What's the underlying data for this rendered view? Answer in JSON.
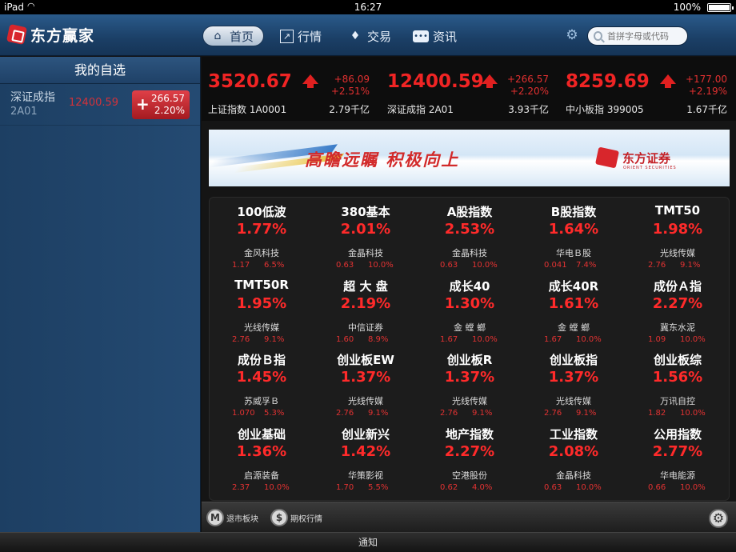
{
  "statusbar": {
    "device": "iPad",
    "time": "16:27",
    "battery": "100%"
  },
  "app": {
    "name": "东方赢家"
  },
  "nav": {
    "tabs": [
      {
        "label": "首页",
        "icon": "home-icon",
        "active": true
      },
      {
        "label": "行情",
        "icon": "chart-icon",
        "active": false
      },
      {
        "label": "交易",
        "icon": "money-bag-icon",
        "active": false
      },
      {
        "label": "资讯",
        "icon": "chat-icon",
        "active": false
      }
    ],
    "search_placeholder": "首拼字母或代码"
  },
  "sidebar": {
    "title": "我的自选",
    "items": [
      {
        "name": "深证成指",
        "code": "2A01",
        "price": "12400.59",
        "change": "266.57",
        "pct": "2.20%"
      }
    ]
  },
  "indices": [
    {
      "price": "3520.67",
      "change": "+86.09",
      "pct": "+2.51%",
      "name": "上证指数 1A0001",
      "volume": "2.79千亿"
    },
    {
      "price": "12400.59",
      "change": "+266.57",
      "pct": "+2.20%",
      "name": "深证成指 2A01",
      "volume": "3.93千亿"
    },
    {
      "price": "8259.69",
      "change": "+177.00",
      "pct": "+2.19%",
      "name": "中小板指 399005",
      "volume": "1.67千亿"
    }
  ],
  "banner": {
    "slogan": "高瞻远瞩  积极向上",
    "brand": "东方证券",
    "brand_en": "ORIENT SECURITIES"
  },
  "sectors": [
    {
      "name": "100低波",
      "pct": "1.77%",
      "stock": "金风科技",
      "price": "1.17",
      "rise": "6.5%"
    },
    {
      "name": "380基本",
      "pct": "2.01%",
      "stock": "金晶科技",
      "price": "0.63",
      "rise": "10.0%"
    },
    {
      "name": "A股指数",
      "pct": "2.53%",
      "stock": "金晶科技",
      "price": "0.63",
      "rise": "10.0%"
    },
    {
      "name": "B股指数",
      "pct": "1.64%",
      "stock": "华电Ｂ股",
      "price": "0.041",
      "rise": "7.4%"
    },
    {
      "name": "TMT50",
      "pct": "1.98%",
      "stock": "光线传媒",
      "price": "2.76",
      "rise": "9.1%"
    },
    {
      "name": "TMT50R",
      "pct": "1.95%",
      "stock": "光线传媒",
      "price": "2.76",
      "rise": "9.1%"
    },
    {
      "name": "超 大 盘",
      "pct": "2.19%",
      "stock": "中信证券",
      "price": "1.60",
      "rise": "8.9%"
    },
    {
      "name": "成长40",
      "pct": "1.30%",
      "stock": "金 螳 螂",
      "price": "1.67",
      "rise": "10.0%"
    },
    {
      "name": "成长40R",
      "pct": "1.61%",
      "stock": "金 螳 螂",
      "price": "1.67",
      "rise": "10.0%"
    },
    {
      "name": "成份Ａ指",
      "pct": "2.27%",
      "stock": "冀东水泥",
      "price": "1.09",
      "rise": "10.0%"
    },
    {
      "name": "成份Ｂ指",
      "pct": "1.45%",
      "stock": "苏威孚Ｂ",
      "price": "1.070",
      "rise": "5.3%"
    },
    {
      "name": "创业板EW",
      "pct": "1.37%",
      "stock": "光线传媒",
      "price": "2.76",
      "rise": "9.1%"
    },
    {
      "name": "创业板R",
      "pct": "1.37%",
      "stock": "光线传媒",
      "price": "2.76",
      "rise": "9.1%"
    },
    {
      "name": "创业板指",
      "pct": "1.37%",
      "stock": "光线传媒",
      "price": "2.76",
      "rise": "9.1%"
    },
    {
      "name": "创业板综",
      "pct": "1.56%",
      "stock": "万讯自控",
      "price": "1.82",
      "rise": "10.0%"
    },
    {
      "name": "创业基础",
      "pct": "1.36%",
      "stock": "启源装备",
      "price": "2.37",
      "rise": "10.0%"
    },
    {
      "name": "创业新兴",
      "pct": "1.42%",
      "stock": "华策影视",
      "price": "1.70",
      "rise": "5.5%"
    },
    {
      "name": "地产指数",
      "pct": "2.27%",
      "stock": "空港股份",
      "price": "0.62",
      "rise": "4.0%"
    },
    {
      "name": "工业指数",
      "pct": "2.08%",
      "stock": "金晶科技",
      "price": "0.63",
      "rise": "10.0%"
    },
    {
      "name": "公用指数",
      "pct": "2.77%",
      "stock": "华电能源",
      "price": "0.66",
      "rise": "10.0%"
    }
  ],
  "bottombar": {
    "delisted_label": "退市板块",
    "options_label": "期权行情"
  },
  "notice": {
    "label": "通知"
  },
  "colors": {
    "up": "#ff2a2a",
    "nav": "#1b3f66",
    "accent": "#d8262c"
  }
}
